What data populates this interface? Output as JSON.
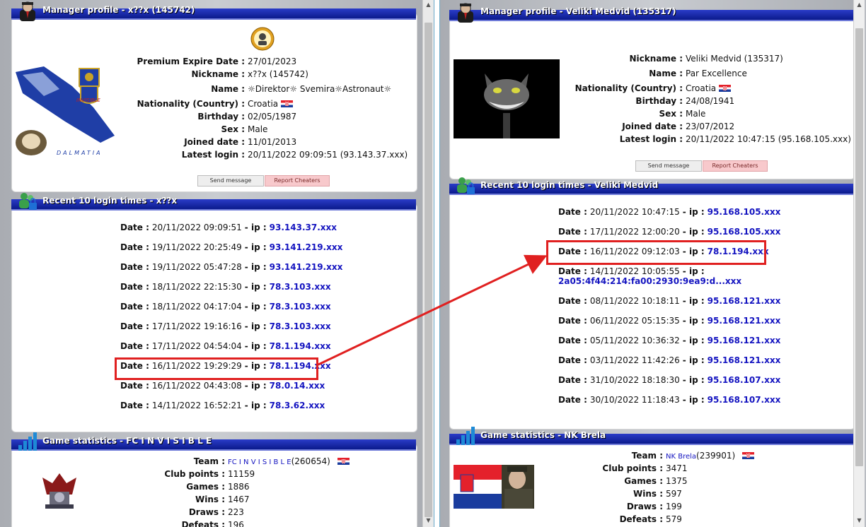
{
  "left": {
    "profile_title": "Manager profile - x??x (145742)",
    "profile": [
      {
        "label": "Premium Expire Date :",
        "value": "27/01/2023"
      },
      {
        "label": "Nickname :",
        "value": "x??x (145742)"
      },
      {
        "label": "Name :",
        "value": "☼Direktor☼  Svemira☼Astronaut☼"
      },
      {
        "label": "Nationality (Country) :",
        "value": "Croatia"
      },
      {
        "label": "Birthday :",
        "value": "02/05/1987"
      },
      {
        "label": "Sex :",
        "value": "Male"
      },
      {
        "label": "Joined date :",
        "value": "11/01/2013"
      },
      {
        "label": "Latest login :",
        "value": "20/11/2022 09:09:51 (93.143.37.xxx)"
      }
    ],
    "logo_text": "INVISIBLE",
    "logo_subtext": "DALMATIA",
    "send_message": "Send message",
    "report_cheaters": "Report Cheaters",
    "logins_title": "Recent 10 login times - x??x",
    "logins": [
      {
        "date": "20/11/2022 09:09:51",
        "ip": "93.143.37.xxx"
      },
      {
        "date": "19/11/2022 20:25:49",
        "ip": "93.141.219.xxx"
      },
      {
        "date": "19/11/2022 05:47:28",
        "ip": "93.141.219.xxx"
      },
      {
        "date": "18/11/2022 22:15:30",
        "ip": "78.3.103.xxx"
      },
      {
        "date": "18/11/2022 04:17:04",
        "ip": "78.3.103.xxx"
      },
      {
        "date": "17/11/2022 19:16:16",
        "ip": "78.3.103.xxx"
      },
      {
        "date": "17/11/2022 04:54:04",
        "ip": "78.1.194.xxx"
      },
      {
        "date": "16/11/2022 19:29:29",
        "ip": "78.1.194.xxx"
      },
      {
        "date": "16/11/2022 04:43:08",
        "ip": "78.0.14.xxx"
      },
      {
        "date": "14/11/2022 16:52:21",
        "ip": "78.3.62.xxx"
      }
    ],
    "stats_title": "Game statistics - FC I N V I S I B L E",
    "team_label": "Team :",
    "team_name": "FC I N V I S I B L E",
    "team_id": "(260654)",
    "stats": [
      {
        "label": "Club points :",
        "value": "11159"
      },
      {
        "label": "Games :",
        "value": "1886"
      },
      {
        "label": "Wins :",
        "value": "1467"
      },
      {
        "label": "Draws :",
        "value": "223"
      },
      {
        "label": "Defeats :",
        "value": "196"
      }
    ]
  },
  "right": {
    "profile_title": "Manager profile - Veliki Medvid (135317)",
    "profile": [
      {
        "label": "Nickname :",
        "value": "Veliki Medvid (135317)"
      },
      {
        "label": "Name :",
        "value": "Par   Excellence"
      },
      {
        "label": "Nationality (Country) :",
        "value": "Croatia"
      },
      {
        "label": "Birthday :",
        "value": "24/08/1941"
      },
      {
        "label": "Sex :",
        "value": "Male"
      },
      {
        "label": "Joined date :",
        "value": "23/07/2012"
      },
      {
        "label": "Latest login :",
        "value": "20/11/2022 10:47:15 (95.168.105.xxx)"
      }
    ],
    "send_message": "Send message",
    "report_cheaters": "Report Cheaters",
    "logins_title": "Recent 10 login times - Veliki Medvid",
    "logins": [
      {
        "date": "20/11/2022 10:47:15",
        "ip": "95.168.105.xxx"
      },
      {
        "date": "17/11/2022 12:00:20",
        "ip": "95.168.105.xxx"
      },
      {
        "date": "16/11/2022 09:12:03",
        "ip": "78.1.194.xxx"
      },
      {
        "date": "14/11/2022 10:05:55",
        "ip": "2a05:4f44:214:fa00:2930:9ea9:d...xxx"
      },
      {
        "date": "08/11/2022 10:18:11",
        "ip": "95.168.121.xxx"
      },
      {
        "date": "06/11/2022 05:15:35",
        "ip": "95.168.121.xxx"
      },
      {
        "date": "05/11/2022 10:36:32",
        "ip": "95.168.121.xxx"
      },
      {
        "date": "03/11/2022 11:42:26",
        "ip": "95.168.121.xxx"
      },
      {
        "date": "31/10/2022 18:18:30",
        "ip": "95.168.107.xxx"
      },
      {
        "date": "30/10/2022 11:18:43",
        "ip": "95.168.107.xxx"
      }
    ],
    "stats_title": "Game statistics - NK Brela",
    "team_label": "Team :",
    "team_name": "NK Brela",
    "team_id": "(239901)",
    "stats": [
      {
        "label": "Club points :",
        "value": "3471"
      },
      {
        "label": "Games :",
        "value": "1375"
      },
      {
        "label": "Wins :",
        "value": "597"
      },
      {
        "label": "Draws :",
        "value": "199"
      },
      {
        "label": "Defeats :",
        "value": "579"
      }
    ]
  },
  "common": {
    "date_label": "Date :",
    "ip_label": "- ip :"
  },
  "colors": {
    "header_blue": "#0b1a8c",
    "ip_blue": "#1414c0",
    "highlight_red": "#e02020",
    "croatia_red": "#e4212b",
    "croatia_blue": "#1a3c9e"
  },
  "icons": {
    "profile": "manager-avatar-icon",
    "logins": "users-lock-icon",
    "stats": "bar-chart-icon"
  }
}
